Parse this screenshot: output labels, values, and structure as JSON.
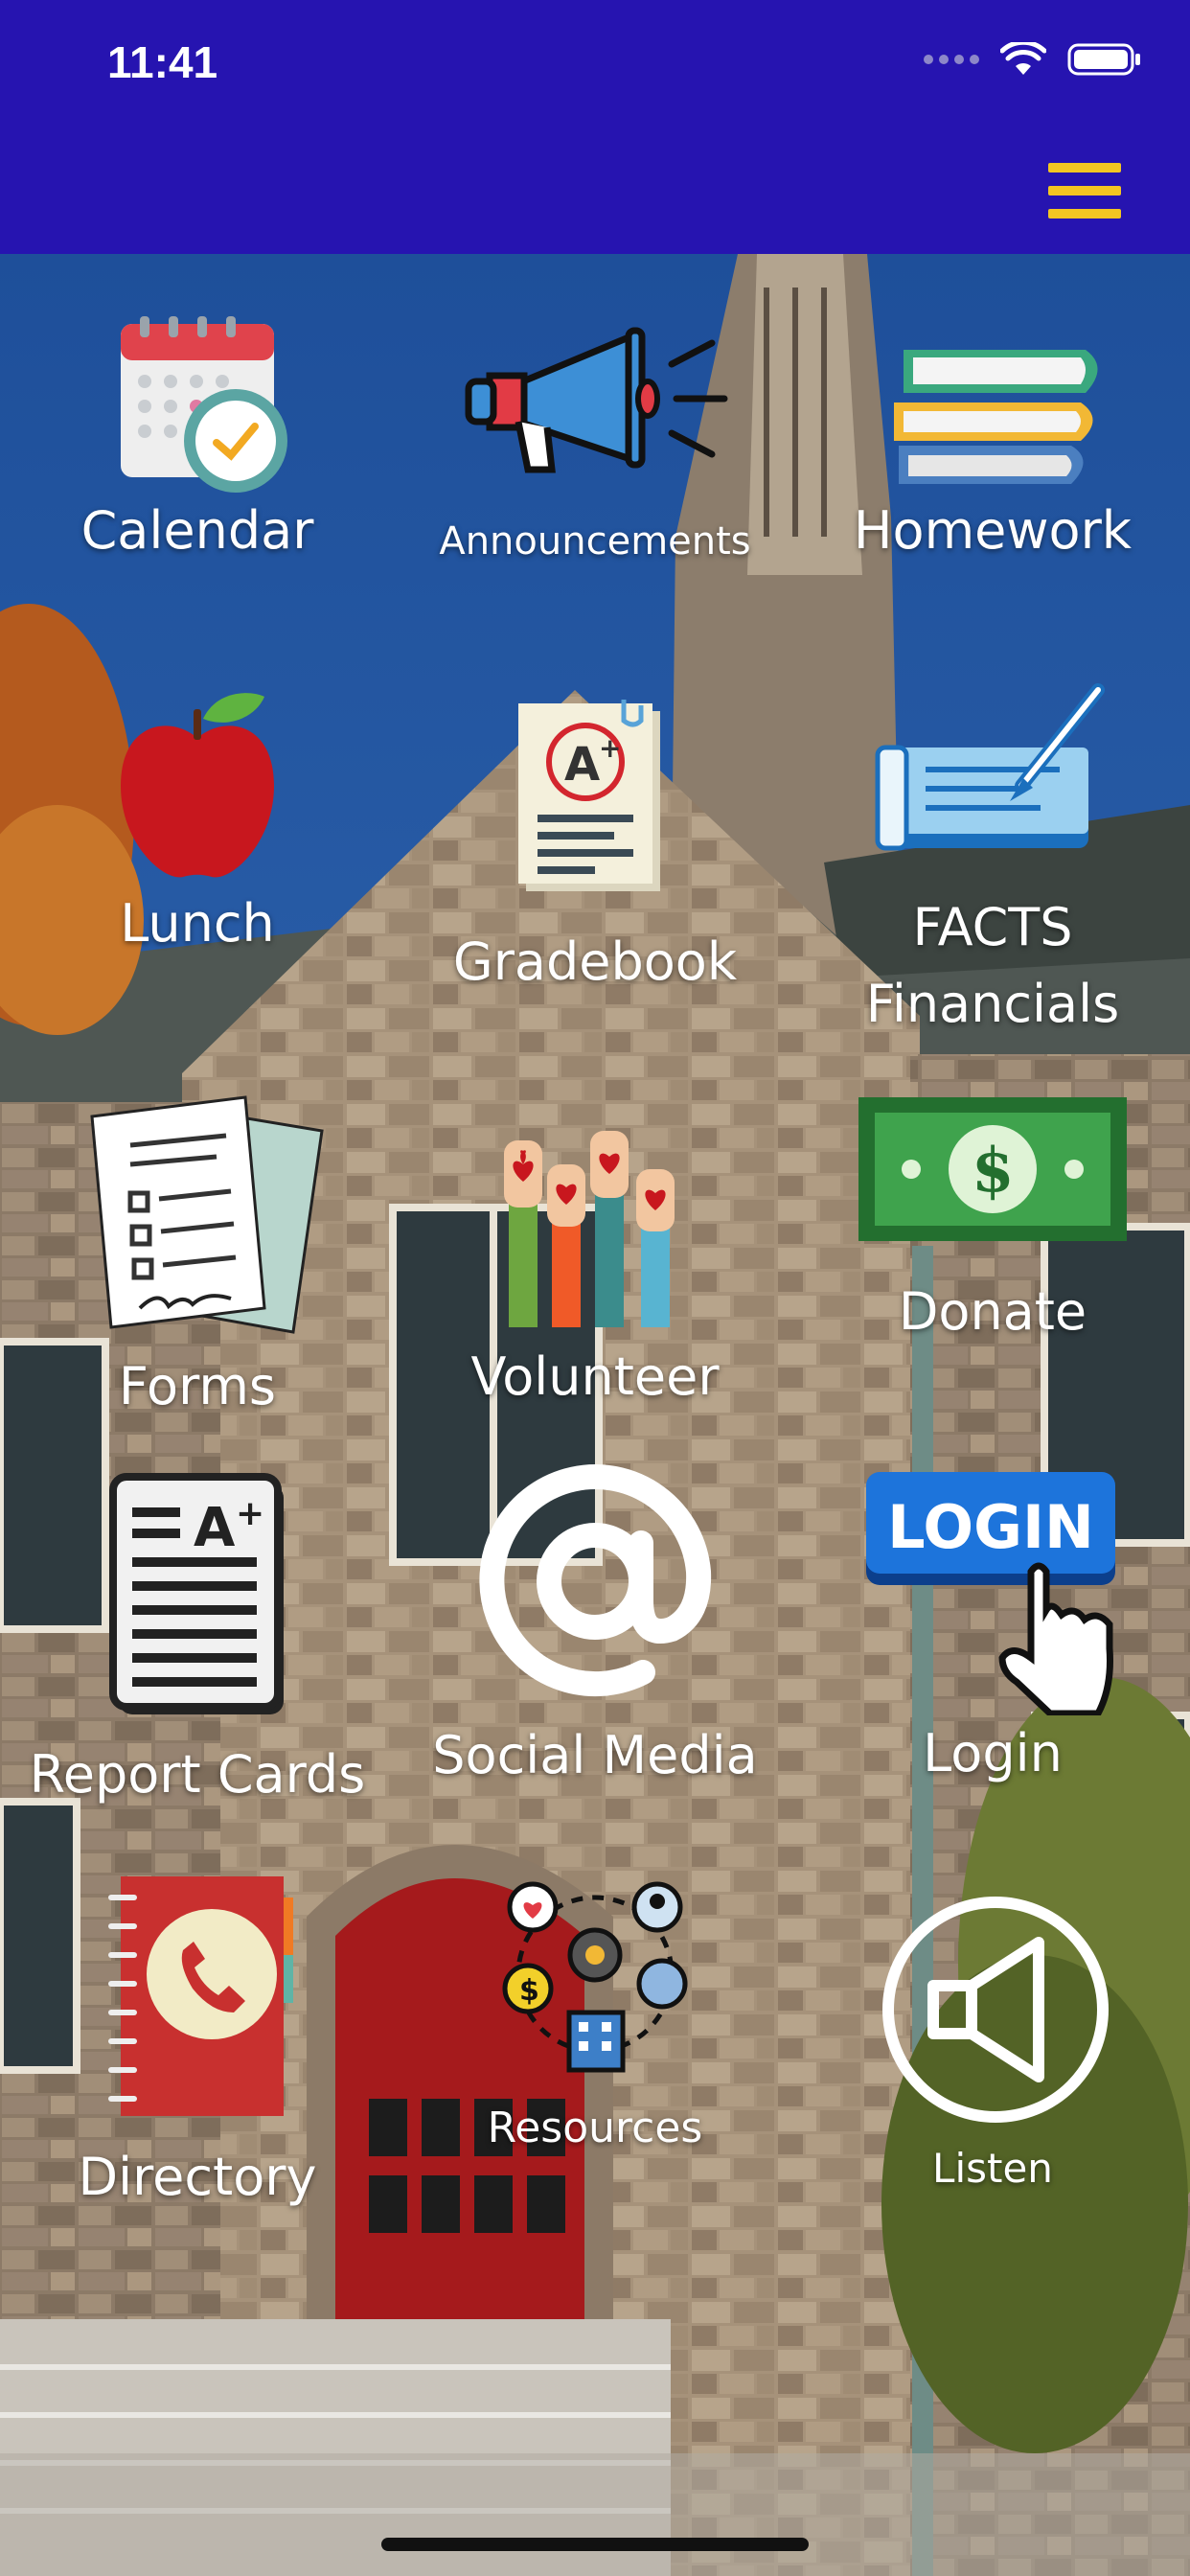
{
  "status_bar": {
    "time": "11:41"
  },
  "header": {
    "menu_icon": "hamburger-icon",
    "bar_color": "#2614b0",
    "menu_color": "#f3c622"
  },
  "tiles": [
    {
      "label": "Calendar",
      "icon": "calendar-icon"
    },
    {
      "label": "Announcements",
      "icon": "megaphone-icon"
    },
    {
      "label": "Homework",
      "icon": "books-icon"
    },
    {
      "label": "Lunch",
      "icon": "apple-icon"
    },
    {
      "label": "Gradebook",
      "icon": "graded-paper-icon"
    },
    {
      "label": "FACTS Financials",
      "icon": "checkbook-icon"
    },
    {
      "label": "Forms",
      "icon": "forms-icon"
    },
    {
      "label": "Volunteer",
      "icon": "raised-hands-icon"
    },
    {
      "label": "Donate",
      "icon": "dollar-bill-icon"
    },
    {
      "label": "Report Cards",
      "icon": "report-card-icon"
    },
    {
      "label": "Social Media",
      "icon": "at-sign-icon"
    },
    {
      "label": "Login",
      "icon": "login-button-icon",
      "badge_text": "LOGIN"
    },
    {
      "label": "Directory",
      "icon": "phone-book-icon"
    },
    {
      "label": "Resources",
      "icon": "resources-network-icon"
    },
    {
      "label": "Listen",
      "icon": "speaker-icon"
    }
  ]
}
